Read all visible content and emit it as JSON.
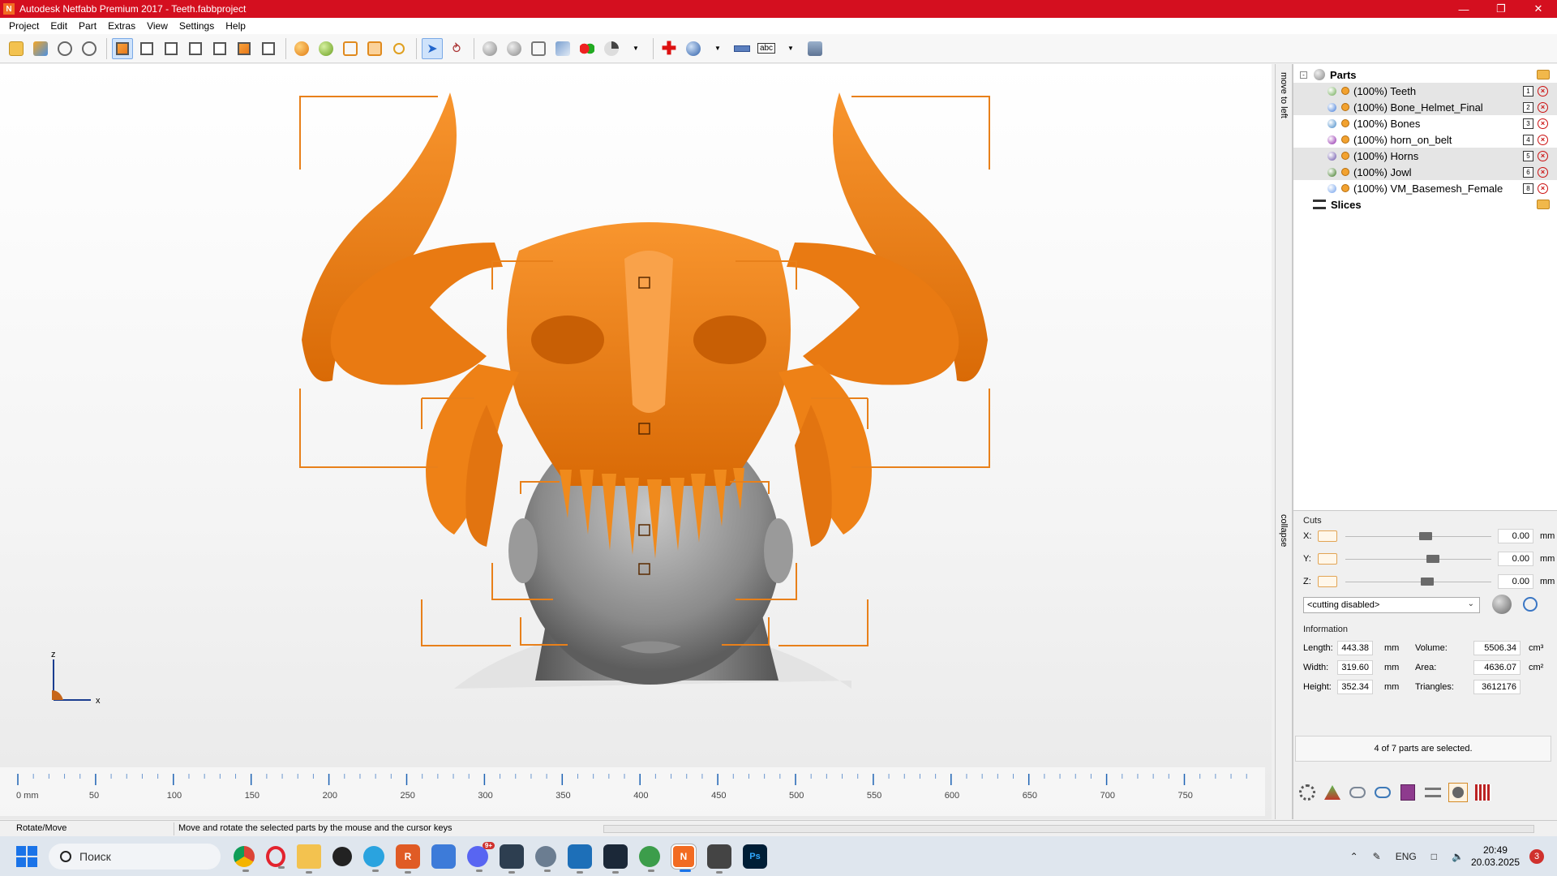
{
  "window": {
    "title": "Autodesk Netfabb Premium 2017 - Teeth.fabbproject",
    "logo": "N"
  },
  "menu": [
    "Project",
    "Edit",
    "Part",
    "Extras",
    "View",
    "Settings",
    "Help"
  ],
  "side_tabs": {
    "move_to_left": "move to left",
    "collapse": "collapse"
  },
  "parts_tree": {
    "root_label": "Parts",
    "slices_label": "Slices",
    "items": [
      {
        "label": "(100%) Teeth",
        "index": "1",
        "color": "#6aa84f",
        "selected": true
      },
      {
        "label": "(100%) Bone_Helmet_Final",
        "index": "2",
        "color": "#3c78d8",
        "selected": true
      },
      {
        "label": "(100%) Bones",
        "index": "3",
        "color": "#3d85c6",
        "selected": false
      },
      {
        "label": "(100%) horn_on_belt",
        "index": "4",
        "color": "#8e24aa",
        "selected": false
      },
      {
        "label": "(100%) Horns",
        "index": "5",
        "color": "#674ea7",
        "selected": true
      },
      {
        "label": "(100%) Jowl",
        "index": "6",
        "color": "#38761d",
        "selected": true
      },
      {
        "label": "(100%) VM_Basemesh_Female",
        "index": "8",
        "color": "#6d9eeb",
        "selected": false
      }
    ]
  },
  "cuts": {
    "title": "Cuts",
    "rows": [
      {
        "axis": "X:",
        "value": "0.00",
        "unit": "mm",
        "thumb_fraction": 0.55
      },
      {
        "axis": "Y:",
        "value": "0.00",
        "unit": "mm",
        "thumb_fraction": 0.6
      },
      {
        "axis": "Z:",
        "value": "0.00",
        "unit": "mm",
        "thumb_fraction": 0.56
      }
    ],
    "mode": "<cutting disabled>"
  },
  "information": {
    "title": "Information",
    "length_label": "Length:",
    "length": "443.38",
    "length_unit": "mm",
    "width_label": "Width:",
    "width": "319.60",
    "width_unit": "mm",
    "height_label": "Height:",
    "height": "352.34",
    "height_unit": "mm",
    "volume_label": "Volume:",
    "volume": "5506.34",
    "volume_unit": "cm³",
    "area_label": "Area:",
    "area": "4636.07",
    "area_unit": "cm²",
    "triangles_label": "Triangles:",
    "triangles": "3612176"
  },
  "selection_status": "4 of 7 parts are selected.",
  "ruler": {
    "labels": [
      "0 mm",
      "50",
      "100",
      "150",
      "200",
      "250",
      "300",
      "350",
      "400",
      "450",
      "500",
      "550",
      "600",
      "650",
      "700",
      "750"
    ]
  },
  "axes": {
    "z": "z",
    "x": "x"
  },
  "statusbar": {
    "mode": "Rotate/Move",
    "hint": "Move and rotate the selected parts by the mouse and the cursor keys"
  },
  "taskbar": {
    "search_placeholder": "Поиск",
    "language": "ENG",
    "time": "20:49",
    "date": "20.03.2025",
    "notifications": "3",
    "discord_badge": "9+"
  },
  "colors": {
    "titlebar": "#d40f1f",
    "model_orange": "#f5841f",
    "model_gray": "#8a8a8a"
  }
}
